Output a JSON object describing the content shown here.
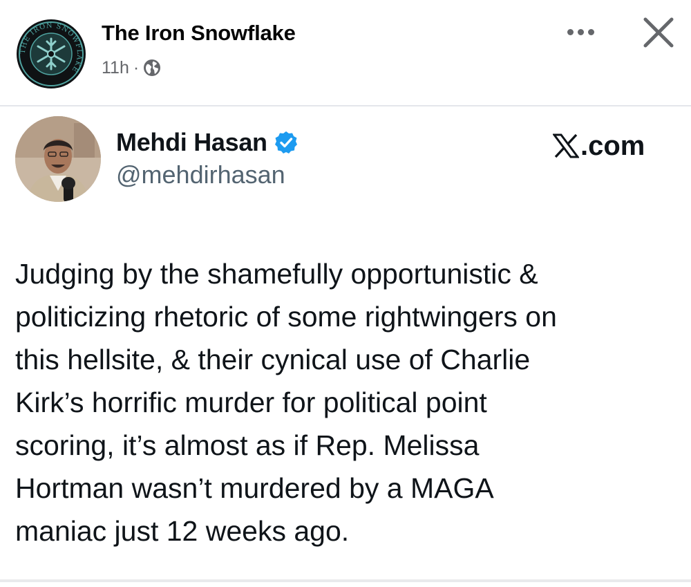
{
  "post": {
    "page_name": "The Iron Snowflake",
    "time_ago": "11h",
    "separator": "·",
    "audience_icon": "globe-icon",
    "more_icon": "more-options-icon",
    "close_icon": "close-icon"
  },
  "logo": {
    "ring_text": "THE IRON SNOWFLAKE",
    "icon": "snowflake-icon"
  },
  "tweet": {
    "author_name": "Mehdi Hasan",
    "verified_icon": "verified-badge-icon",
    "handle": "@mehdirhasan",
    "source_label": ".com",
    "source_icon": "x-logo-icon",
    "text": "Judging by the shamefully opportunistic &\npoliticizing rhetoric of some rightwingers on\nthis hellsite, & their cynical use of Charlie\nKirk’s horrific murder for political point\nscoring, it’s almost as if Rep. Melissa\nHortman wasn’t murdered by a MAGA\nmaniac just 12 weeks ago."
  },
  "colors": {
    "secondary_text": "#65676b",
    "verified_blue": "#1d9bf0",
    "logo_teal": "#4fa3a0",
    "divider": "#e4e6eb"
  }
}
